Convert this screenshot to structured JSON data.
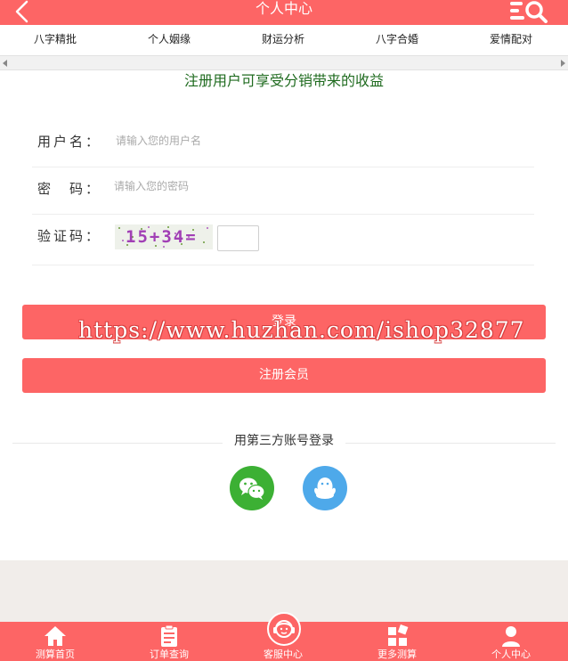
{
  "header": {
    "title": "个人中心",
    "back_icon": "back-arrow-icon",
    "search_icon": "list-search-icon"
  },
  "tabs": [
    {
      "label": "八字精批"
    },
    {
      "label": "个人姻缘"
    },
    {
      "label": "财运分析"
    },
    {
      "label": "八字合婚"
    },
    {
      "label": "爱情配对"
    }
  ],
  "promo": "注册用户可享受分销带来的收益",
  "form": {
    "username_label": "用户名：",
    "username_placeholder": "请输入您的用户名",
    "password_label": "密　码：",
    "password_placeholder": "请输入您的密码",
    "captcha_label": "验证码：",
    "captcha_text": "15+34="
  },
  "buttons": {
    "login": "登录",
    "register": "注册会员"
  },
  "watermark": "https://www.huzhan.com/ishop32877",
  "third_party": {
    "label": "用第三方账号登录",
    "wechat_icon": "wechat-icon",
    "qq_icon": "qq-icon"
  },
  "bottom_nav": [
    {
      "label": "测算首页",
      "icon": "home-icon"
    },
    {
      "label": "订单查询",
      "icon": "clipboard-icon"
    },
    {
      "label": "客服中心",
      "icon": "headset-icon"
    },
    {
      "label": "更多测算",
      "icon": "grid-icon"
    },
    {
      "label": "个人中心",
      "icon": "user-icon"
    }
  ],
  "colors": {
    "accent": "#fd6565",
    "promo_text": "#1f6b1f",
    "wechat": "#3cb034",
    "qq": "#4ea9ea"
  }
}
